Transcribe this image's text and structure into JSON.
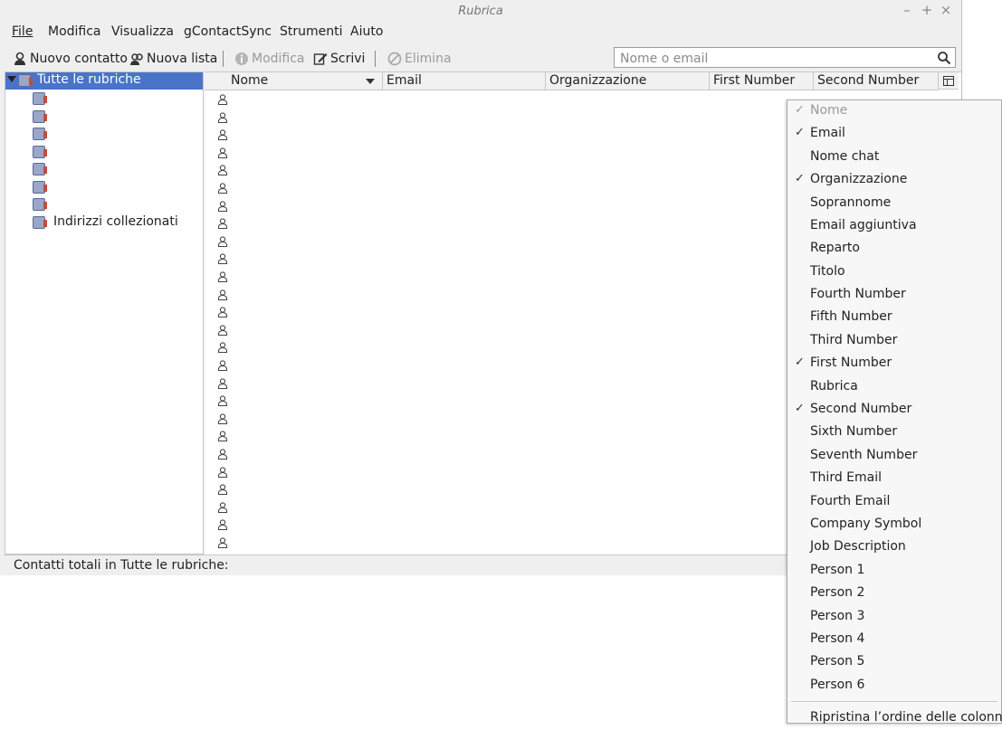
{
  "window": {
    "title": "Rubrica",
    "controls": {
      "minimize": "–",
      "maximize": "+",
      "close": "×"
    }
  },
  "menubar": {
    "items": [
      {
        "label": "File"
      },
      {
        "label": "Modifica"
      },
      {
        "label": "Visualizza"
      },
      {
        "label": "gContactSync"
      },
      {
        "label": "Strumenti"
      },
      {
        "label": "Aiuto"
      }
    ]
  },
  "toolbar": {
    "new_contact": "Nuovo contatto",
    "new_list": "Nuova lista",
    "edit": "Modifica",
    "write": "Scrivi",
    "delete": "Elimina"
  },
  "search": {
    "placeholder": "Nome o email",
    "value": ""
  },
  "tree": {
    "root": "Tutte le rubriche",
    "items": [
      {
        "label": ""
      },
      {
        "label": ""
      },
      {
        "label": ""
      },
      {
        "label": ""
      },
      {
        "label": ""
      },
      {
        "label": ""
      },
      {
        "label": ""
      },
      {
        "label": "Indirizzi collezionati"
      }
    ]
  },
  "columns": {
    "name": "Nome",
    "email": "Email",
    "organization": "Organizzazione",
    "first_number": "First Number",
    "second_number": "Second Number"
  },
  "status": {
    "text": "Contatti totali in Tutte le rubriche:"
  },
  "column_menu": {
    "items": [
      {
        "label": "Nome",
        "checked": "✓",
        "disabled": true
      },
      {
        "label": "Email",
        "checked": "✓"
      },
      {
        "label": "Nome chat",
        "checked": ""
      },
      {
        "label": "Organizzazione",
        "checked": "✓"
      },
      {
        "label": "Soprannome",
        "checked": ""
      },
      {
        "label": "Email aggiuntiva",
        "checked": ""
      },
      {
        "label": "Reparto",
        "checked": ""
      },
      {
        "label": "Titolo",
        "checked": ""
      },
      {
        "label": "Fourth Number",
        "checked": ""
      },
      {
        "label": "Fifth Number",
        "checked": ""
      },
      {
        "label": "Third Number",
        "checked": ""
      },
      {
        "label": "First Number",
        "checked": "✓"
      },
      {
        "label": "Rubrica",
        "checked": ""
      },
      {
        "label": "Second Number",
        "checked": "✓"
      },
      {
        "label": "Sixth Number",
        "checked": ""
      },
      {
        "label": "Seventh Number",
        "checked": ""
      },
      {
        "label": "Third Email",
        "checked": ""
      },
      {
        "label": "Fourth Email",
        "checked": ""
      },
      {
        "label": "Company Symbol",
        "checked": ""
      },
      {
        "label": "Job Description",
        "checked": ""
      },
      {
        "label": "Person 1",
        "checked": ""
      },
      {
        "label": "Person 2",
        "checked": ""
      },
      {
        "label": "Person 3",
        "checked": ""
      },
      {
        "label": "Person 4",
        "checked": ""
      },
      {
        "label": "Person 5",
        "checked": ""
      },
      {
        "label": "Person 6",
        "checked": ""
      }
    ],
    "restore": "Ripristina l’ordine delle colonne"
  },
  "colors": {
    "selection": "#4a74c8",
    "window_bg": "#efefef"
  }
}
